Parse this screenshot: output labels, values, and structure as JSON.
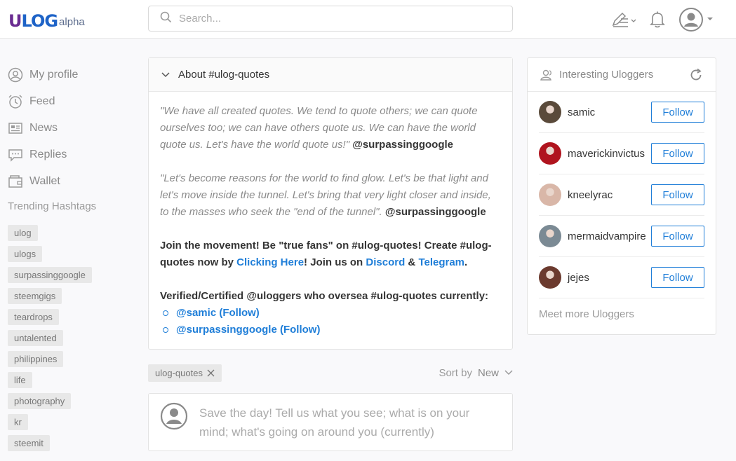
{
  "header": {
    "logo_text": "ULOG",
    "logo_suffix": "alpha",
    "search_placeholder": "Search..."
  },
  "sidebar": {
    "nav": [
      {
        "label": "My profile",
        "icon": "profile-icon"
      },
      {
        "label": "Feed",
        "icon": "clock-icon"
      },
      {
        "label": "News",
        "icon": "news-icon"
      },
      {
        "label": "Replies",
        "icon": "chat-icon"
      },
      {
        "label": "Wallet",
        "icon": "wallet-icon"
      }
    ],
    "trending_title": "Trending Hashtags",
    "tags": [
      "ulog",
      "ulogs",
      "surpassinggoogle",
      "steemgigs",
      "teardrops",
      "untalented",
      "philippines",
      "life",
      "photography",
      "kr",
      "steemit"
    ]
  },
  "about": {
    "title": "About #ulog-quotes",
    "quote1": "\"We have all created quotes. We tend to quote others; we can quote ourselves too; we can have others quote us. We can have the world quote us. Let's have the world quote us!\"",
    "quote1_author": "@surpassinggoogle",
    "quote2": "\"Let's become reasons for the world to find glow. Let's be that light and let's move inside the tunnel. Let's bring that very light closer and inside, to the masses who seek the \"end of the tunnel\".",
    "quote2_author": "@surpassinggoogle",
    "join_text_1": "Join the movement! Be \"true fans\" on #ulog-quotes! Create #ulog-quotes now by",
    "join_link_clicking": "Clicking Here",
    "join_text_2": "! Join us on",
    "join_link_discord": "Discord",
    "join_amp": "&",
    "join_link_telegram": "Telegram",
    "join_end": ".",
    "verified_title": "Verified/Certified @uloggers who oversea #ulog-quotes currently:",
    "verified": [
      "@samic (Follow)",
      "@surpassinggoogle (Follow)"
    ]
  },
  "filter": {
    "active_tag": "ulog-quotes",
    "sort_label": "Sort by",
    "sort_value": "New"
  },
  "compose": {
    "placeholder": "Save the day! Tell us what you see; what is on your mind; what's going on around you (currently)"
  },
  "right": {
    "title": "Interesting Uloggers",
    "follow_label": "Follow",
    "users": [
      {
        "name": "samic",
        "color": "#5a4a3a"
      },
      {
        "name": "maverickinvictus",
        "color": "#b0141e"
      },
      {
        "name": "kneelyrac",
        "color": "#d9b7a8"
      },
      {
        "name": "mermaidvampire",
        "color": "#7b8a94"
      },
      {
        "name": "jejes",
        "color": "#6b3a2e"
      }
    ],
    "meet_more": "Meet more Uloggers"
  }
}
